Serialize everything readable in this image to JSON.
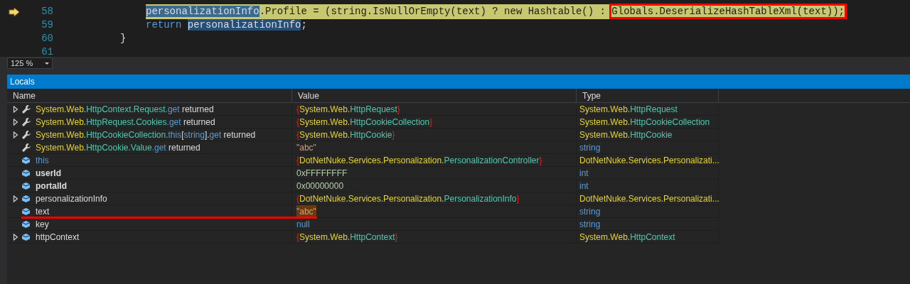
{
  "editor": {
    "lines": [
      {
        "number": "58",
        "current": true,
        "kind": "statement",
        "segments": [
          {
            "text": "personalizationInfo",
            "kind": "selection"
          },
          {
            "text": ".Profile = (string.IsNullOrEmpty(text) ? new Hashtable() : ",
            "kind": "plain"
          },
          {
            "text": "Globals.DeserializeHashTableXml(text));",
            "kind": "boxed"
          }
        ]
      },
      {
        "number": "59",
        "current": false,
        "kind": "statement",
        "segments": [
          {
            "text": "return ",
            "kind": "kw"
          },
          {
            "text": "personalizationInfo",
            "kind": "reference"
          },
          {
            "text": ";",
            "kind": "plain"
          }
        ]
      },
      {
        "number": "60",
        "current": false,
        "kind": "block-end",
        "segments": [
          {
            "text": "}",
            "kind": "plain"
          }
        ]
      },
      {
        "number": "61",
        "current": false,
        "kind": "blank"
      }
    ],
    "zoom": "125 %"
  },
  "locals": {
    "title": "Locals",
    "columns": [
      "Name",
      "Value",
      "Type"
    ],
    "rows": [
      {
        "expandable": true,
        "kind": "return-value",
        "bold": false,
        "changed": false,
        "name": [
          {
            "text": "System.Web.",
            "kind": "ns"
          },
          {
            "text": "HttpContext.",
            "kind": "type"
          },
          {
            "text": "Request",
            "kind": "type"
          },
          {
            "text": ".get",
            "kind": "kw"
          },
          {
            "text": " returned",
            "kind": "plain"
          }
        ],
        "value": [
          {
            "text": "{",
            "kind": "brace"
          },
          {
            "text": "System.Web.",
            "kind": "ns"
          },
          {
            "text": "HttpRequest",
            "kind": "type"
          },
          {
            "text": "}",
            "kind": "brace"
          }
        ],
        "type": [
          {
            "text": "System.Web.",
            "kind": "ns"
          },
          {
            "text": "HttpRequest",
            "kind": "type"
          }
        ]
      },
      {
        "expandable": true,
        "kind": "return-value",
        "bold": false,
        "changed": false,
        "name": [
          {
            "text": "System.Web.",
            "kind": "ns"
          },
          {
            "text": "HttpRequest.",
            "kind": "type"
          },
          {
            "text": "Cookies",
            "kind": "type"
          },
          {
            "text": ".get",
            "kind": "kw"
          },
          {
            "text": " returned",
            "kind": "plain"
          }
        ],
        "value": [
          {
            "text": "{",
            "kind": "brace"
          },
          {
            "text": "System.Web.",
            "kind": "ns"
          },
          {
            "text": "HttpCookieCollection",
            "kind": "type"
          },
          {
            "text": "}",
            "kind": "brace"
          }
        ],
        "type": [
          {
            "text": "System.Web.",
            "kind": "ns"
          },
          {
            "text": "HttpCookieCollection",
            "kind": "type"
          }
        ]
      },
      {
        "expandable": true,
        "kind": "return-value",
        "bold": false,
        "changed": false,
        "name": [
          {
            "text": "System.Web.",
            "kind": "ns"
          },
          {
            "text": "HttpCookieCollection.",
            "kind": "type"
          },
          {
            "text": "this",
            "kind": "kw"
          },
          {
            "text": "[",
            "kind": "plain"
          },
          {
            "text": "string",
            "kind": "kw"
          },
          {
            "text": "].",
            "kind": "plain"
          },
          {
            "text": "get",
            "kind": "kw"
          },
          {
            "text": " returned",
            "kind": "plain"
          }
        ],
        "value": [
          {
            "text": "{",
            "kind": "brace"
          },
          {
            "text": "System.Web.",
            "kind": "ns"
          },
          {
            "text": "HttpCookie",
            "kind": "type"
          },
          {
            "text": "}",
            "kind": "brace"
          }
        ],
        "type": [
          {
            "text": "System.Web.",
            "kind": "ns"
          },
          {
            "text": "HttpCookie",
            "kind": "type"
          }
        ]
      },
      {
        "expandable": false,
        "kind": "return-value",
        "bold": false,
        "changed": false,
        "name": [
          {
            "text": "System.Web.",
            "kind": "ns"
          },
          {
            "text": "HttpCookie.",
            "kind": "type"
          },
          {
            "text": "Value",
            "kind": "type"
          },
          {
            "text": ".get",
            "kind": "kw"
          },
          {
            "text": " returned",
            "kind": "plain"
          }
        ],
        "value": [
          {
            "text": "\"abc\"",
            "kind": "string"
          }
        ],
        "type": [
          {
            "text": "string",
            "kind": "kw"
          }
        ]
      },
      {
        "expandable": false,
        "kind": "variable",
        "bold": false,
        "changed": false,
        "name": [
          {
            "text": "this",
            "kind": "kw"
          }
        ],
        "value": [
          {
            "text": "{",
            "kind": "brace"
          },
          {
            "text": "DotNetNuke.Services.Personalization.",
            "kind": "ns"
          },
          {
            "text": "PersonalizationController",
            "kind": "type"
          },
          {
            "text": "}",
            "kind": "brace"
          }
        ],
        "type": [
          {
            "text": "DotNetNuke.Services.Personalizati...",
            "kind": "ns"
          }
        ]
      },
      {
        "expandable": false,
        "kind": "variable",
        "bold": true,
        "changed": false,
        "name": [
          {
            "text": "userId",
            "kind": "plain"
          }
        ],
        "value": [
          {
            "text": "0xFFFFFFFF",
            "kind": "number"
          }
        ],
        "type": [
          {
            "text": "int",
            "kind": "kw"
          }
        ]
      },
      {
        "expandable": false,
        "kind": "variable",
        "bold": true,
        "changed": false,
        "name": [
          {
            "text": "portalId",
            "kind": "plain"
          }
        ],
        "value": [
          {
            "text": "0x00000000",
            "kind": "number"
          }
        ],
        "type": [
          {
            "text": "int",
            "kind": "kw"
          }
        ]
      },
      {
        "expandable": true,
        "kind": "variable",
        "bold": false,
        "changed": false,
        "name": [
          {
            "text": "personalizationInfo",
            "kind": "plain"
          }
        ],
        "value": [
          {
            "text": "{",
            "kind": "brace"
          },
          {
            "text": "DotNetNuke.Services.Personalization.",
            "kind": "ns"
          },
          {
            "text": "PersonalizationInfo",
            "kind": "type"
          },
          {
            "text": "}",
            "kind": "brace"
          }
        ],
        "type": [
          {
            "text": "DotNetNuke.Services.Personalizati...",
            "kind": "ns"
          }
        ]
      },
      {
        "expandable": false,
        "kind": "variable",
        "bold": false,
        "changed": true,
        "name": [
          {
            "text": "text",
            "kind": "plain"
          }
        ],
        "value": [
          {
            "text": "\"abc\"",
            "kind": "string"
          }
        ],
        "type": [
          {
            "text": "string",
            "kind": "kw"
          }
        ]
      },
      {
        "expandable": false,
        "kind": "variable",
        "bold": false,
        "changed": false,
        "name": [
          {
            "text": "key",
            "kind": "plain"
          }
        ],
        "value": [
          {
            "text": "null",
            "kind": "kw"
          }
        ],
        "type": [
          {
            "text": "string",
            "kind": "kw"
          }
        ]
      },
      {
        "expandable": true,
        "kind": "variable",
        "bold": false,
        "changed": false,
        "name": [
          {
            "text": "httpContext",
            "kind": "plain"
          }
        ],
        "value": [
          {
            "text": "{",
            "kind": "brace"
          },
          {
            "text": "System.Web.",
            "kind": "ns"
          },
          {
            "text": "HttpContext",
            "kind": "type"
          },
          {
            "text": "}",
            "kind": "brace"
          }
        ],
        "type": [
          {
            "text": "System.Web.",
            "kind": "ns"
          },
          {
            "text": "HttpContext",
            "kind": "type"
          }
        ]
      }
    ]
  }
}
